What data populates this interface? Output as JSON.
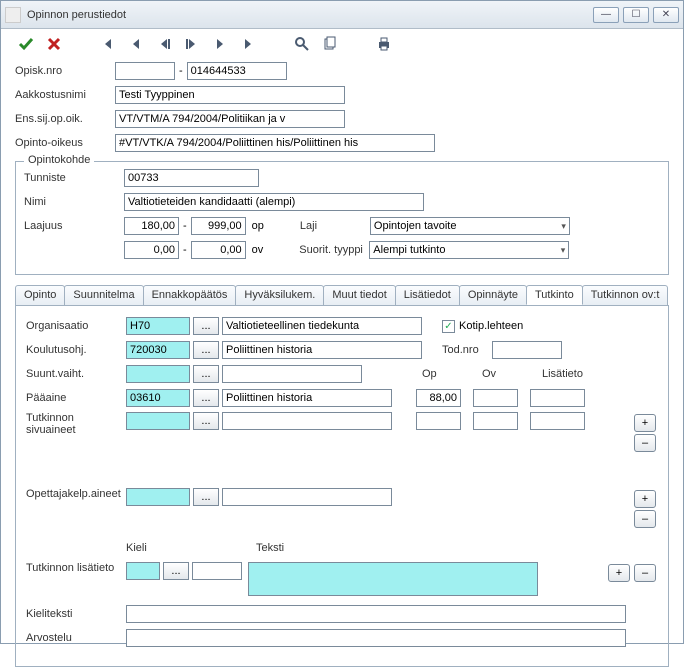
{
  "title": "Opinnon perustiedot",
  "fields": {
    "opisk_nro_lbl": "Opisk.nro",
    "opisk_nro_a": "",
    "opisk_nro_b": "014644533",
    "aakkostusnimi_lbl": "Aakkostusnimi",
    "aakkostusnimi": "Testi Tyyppinen",
    "ens_sij_lbl": "Ens.sij.op.oik.",
    "ens_sij": "VT/VTM/A 794/2004/Politiikan ja v",
    "opinto_oikeus_lbl": "Opinto-oikeus",
    "opinto_oikeus": "#VT/VTK/A 794/2004/Poliittinen his/Poliittinen his"
  },
  "kohde": {
    "legend": "Opintokohde",
    "tunniste_lbl": "Tunniste",
    "tunniste": "00733",
    "nimi_lbl": "Nimi",
    "nimi": "Valtiotieteiden kandidaatti (alempi)",
    "laajuus_lbl": "Laajuus",
    "laaj1a": "180,00",
    "laaj1b": "999,00",
    "laaj2a": "0,00",
    "laaj2b": "0,00",
    "op": "op",
    "ov": "ov",
    "laji_lbl": "Laji",
    "laji": "Opintojen tavoite",
    "suorit_lbl": "Suorit. tyyppi",
    "suorit": "Alempi tutkinto"
  },
  "tabs": [
    "Opinto",
    "Suunnitelma",
    "Ennakkopäätös",
    "Hyväksilukem.",
    "Muut tiedot",
    "Lisätiedot",
    "Opinnäyte",
    "Tutkinto",
    "Tutkinnon ov:t"
  ],
  "active_tab": "Tutkinto",
  "tutkinto": {
    "organisaatio_lbl": "Organisaatio",
    "organisaatio_code": "H70",
    "organisaatio_name": "Valtiotieteellinen tiedekunta",
    "kotip_lbl": "Kotip.lehteen",
    "koulutusohj_lbl": "Koulutusohj.",
    "koulutusohj_code": "720030",
    "koulutusohj_name": "Poliittinen historia",
    "todnro_lbl": "Tod.nro",
    "suuntvaiht_lbl": "Suunt.vaiht.",
    "op_lbl": "Op",
    "ov_lbl": "Ov",
    "lisatieto_lbl": "Lisätieto",
    "paaaine_lbl": "Pääaine",
    "paaaine_code": "03610",
    "paaaine_name": "Poliittinen historia",
    "paaaine_op": "88,00",
    "sivu_lbl": "Tutkinnon sivuaineet",
    "opettaja_lbl": "Opettajakelp.aineet",
    "kieli_lbl": "Kieli",
    "teksti_lbl": "Teksti",
    "tlisa_lbl": "Tutkinnon lisätieto",
    "kieliteksti_lbl": "Kieliteksti",
    "arvostelu_lbl": "Arvostelu",
    "dots": "...",
    "plus": "+",
    "minus": "–"
  }
}
